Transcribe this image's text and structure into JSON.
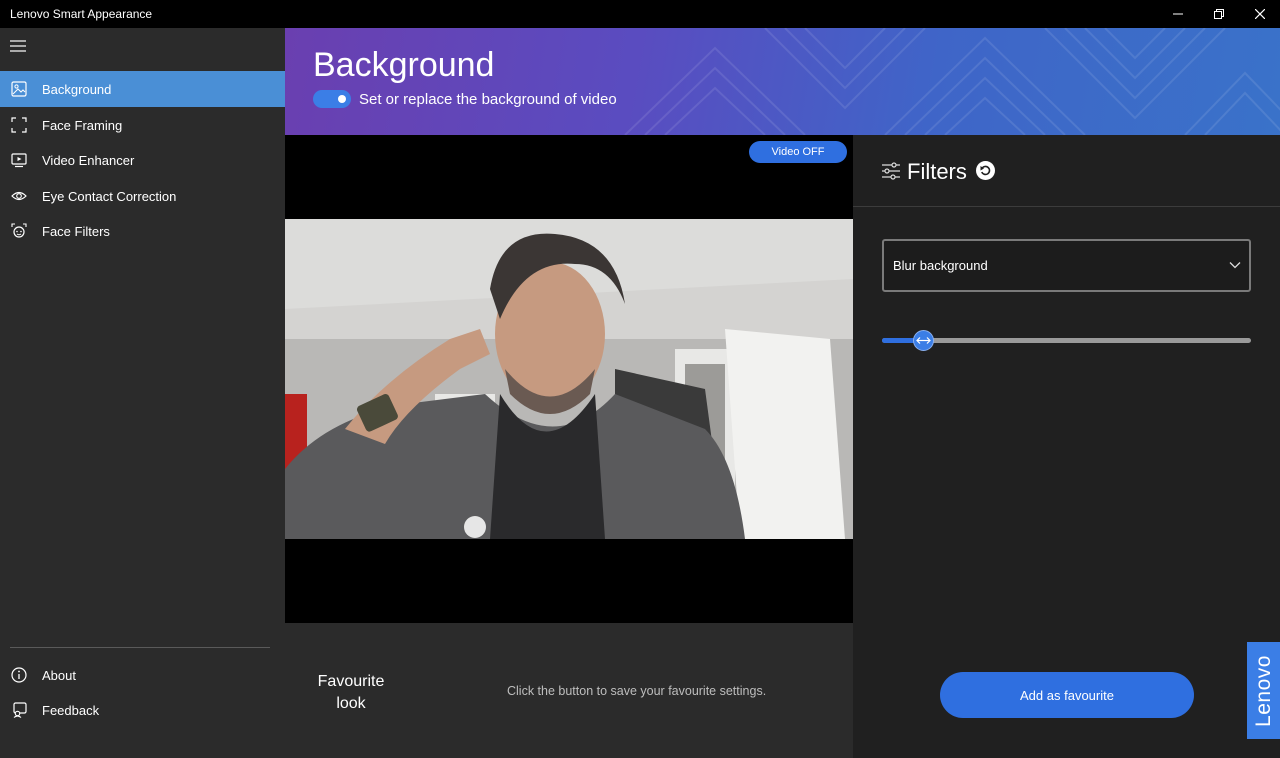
{
  "window": {
    "title": "Lenovo Smart Appearance",
    "controls": [
      "minimize",
      "restore",
      "close"
    ]
  },
  "sidebar": {
    "menu_icon": "hamburger-icon",
    "items": [
      {
        "label": "Background",
        "icon": "background-image-icon",
        "active": true
      },
      {
        "label": "Face Framing",
        "icon": "frame-corners-icon",
        "active": false
      },
      {
        "label": "Video Enhancer",
        "icon": "video-screen-icon",
        "active": false
      },
      {
        "label": "Eye Contact Correction",
        "icon": "eye-icon",
        "active": false
      },
      {
        "label": "Face Filters",
        "icon": "face-filter-icon",
        "active": false
      }
    ],
    "bottom_items": [
      {
        "label": "About",
        "icon": "info-icon"
      },
      {
        "label": "Feedback",
        "icon": "feedback-icon"
      }
    ]
  },
  "header": {
    "title": "Background",
    "toggle_on": true,
    "toggle_label": "Set or replace the background of video"
  },
  "video": {
    "video_off_label": "Video OFF"
  },
  "favourite": {
    "title": "Favourite look",
    "hint": "Click the button to save your favourite settings."
  },
  "filters": {
    "title": "Filters",
    "reset_icon": "reset-icon",
    "dropdown_value": "Blur background",
    "slider_value": 0.11,
    "add_button_label": "Add as favourite"
  },
  "brand": {
    "badge_text": "Lenovo"
  },
  "colors": {
    "accent": "#3b7ee6",
    "active_nav": "#4a8fd6",
    "sidebar_bg": "#2b2b2b",
    "panel_bg": "#202020"
  }
}
